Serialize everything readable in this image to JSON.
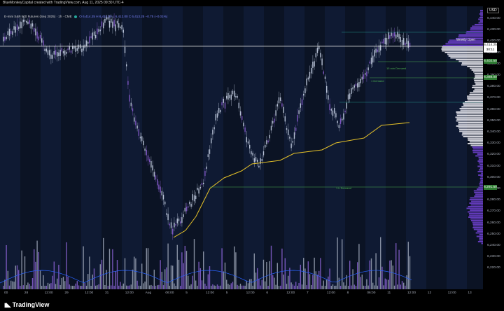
{
  "header": {
    "credit": "BlueMonkeyCapital created with TradingView.com, Aug 11, 2025 09:30 UTC-4"
  },
  "legend": {
    "symbol": "E-mini S&P 500 Futures (Sep 2025) · 1h · CME",
    "ohlc": "O 6,414.25  H 6,415.00  L 6,412.00  C 6,413.25  −0.75 (−0.01%)"
  },
  "currency": "USD",
  "price_axis": [
    "6,440.00",
    "6,430.00",
    "6,420.00",
    "6,410.00",
    "6,400.00",
    "6,390.00",
    "6,380.00",
    "6,370.00",
    "6,360.00",
    "6,350.00",
    "6,340.00",
    "6,330.00",
    "6,320.00",
    "6,310.00",
    "6,300.00",
    "6,290.00",
    "6,280.00",
    "6,270.00",
    "6,260.00",
    "6,250.00",
    "6,240.00",
    "6,230.00",
    "6,220.00"
  ],
  "price_labels": {
    "current": "6,414.25",
    "current_time": "30:11",
    "level_1": "6,402.50",
    "level_2": "6,388.00",
    "level_3": "6,291.50"
  },
  "annotations": {
    "weekly_open": "Weekly Open",
    "demand_1": "1 Demand",
    "demand_2": "15 min Demand",
    "demand_3": "1 h Demand"
  },
  "time_axis": [
    "00",
    "28",
    "12:00",
    "29",
    "12:00",
    "31",
    "12:00",
    "Aug",
    "06:00",
    "5",
    "12:00",
    "5",
    "12:00",
    "6",
    "12:00",
    "7",
    "12:00",
    "8",
    "06:00",
    "11",
    "12:00",
    "12",
    "12:00",
    "13"
  ],
  "footer": {
    "brand": "TradingView"
  },
  "colors": {
    "background": "#0b1324",
    "candle": "#b8c2d6",
    "candle_alt": "#7e57c2",
    "vwap": "#e6c229",
    "demand": "#4caf50",
    "volume_profile": "#6a3fc9"
  }
}
